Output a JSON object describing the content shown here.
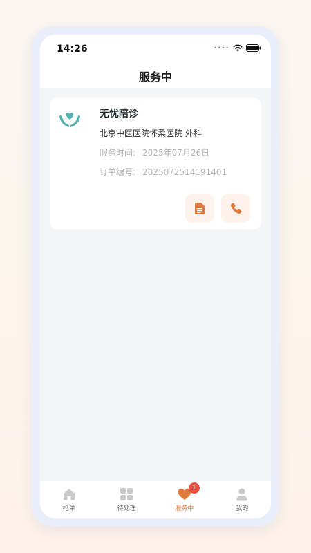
{
  "status_bar": {
    "time": "14:26"
  },
  "nav": {
    "title": "服务中"
  },
  "card": {
    "service_name": "无忧陪诊",
    "hospital": "北京中医医院怀柔医院 外科",
    "time_label": "服务时间:",
    "time_value": "2025年07月26日",
    "order_label": "订单编号:",
    "order_value": "2025072514191401"
  },
  "tabs": [
    {
      "label": "抢单",
      "icon": "home-icon"
    },
    {
      "label": "待处理",
      "icon": "grid-icon"
    },
    {
      "label": "服务中",
      "icon": "heart-icon",
      "badge": "1"
    },
    {
      "label": "我的",
      "icon": "person-icon"
    }
  ],
  "colors": {
    "accent": "#e07a3c",
    "logo_teal": "#4fb0ae",
    "badge_red": "#e84f3d"
  }
}
